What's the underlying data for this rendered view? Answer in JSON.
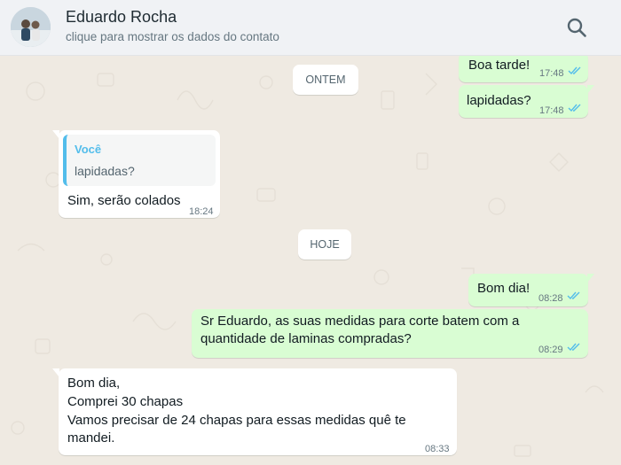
{
  "header": {
    "contact_name": "Eduardo Rocha",
    "subtitle": "clique para mostrar os dados do contato"
  },
  "icons": {
    "search": "search-icon",
    "avatar": "avatar",
    "read_ticks": "double-check-icon"
  },
  "colors": {
    "outgoing_bubble": "#d9fdd3",
    "incoming_bubble": "#ffffff",
    "read_tick": "#53bdeb",
    "quote_accent": "#53bdeb"
  },
  "messages": [
    {
      "direction": "out",
      "text": "Boa tarde!",
      "time": "17:48",
      "read": true
    },
    {
      "direction": "out",
      "text": "lapidadas?",
      "time": "17:48",
      "read": true
    },
    {
      "direction": "in",
      "quote_author": "Você",
      "quote_text": "lapidadas?",
      "text": "Sim, serão colados",
      "time": "18:24"
    },
    {
      "direction": "out",
      "text": "Bom dia!",
      "time": "08:28",
      "read": true
    },
    {
      "direction": "out",
      "lines": [
        "Sr Eduardo, as suas medidas para corte batem com a",
        "quantidade de laminas compradas?"
      ],
      "time": "08:29",
      "read": true
    },
    {
      "direction": "in",
      "lines": [
        "Bom dia,",
        "Comprei 30 chapas",
        "Vamos precisar de 24 chapas para essas medidas quê te",
        "mandei."
      ],
      "time": "08:33"
    }
  ],
  "dates": {
    "yesterday": "ONTEM",
    "today": "HOJE"
  }
}
